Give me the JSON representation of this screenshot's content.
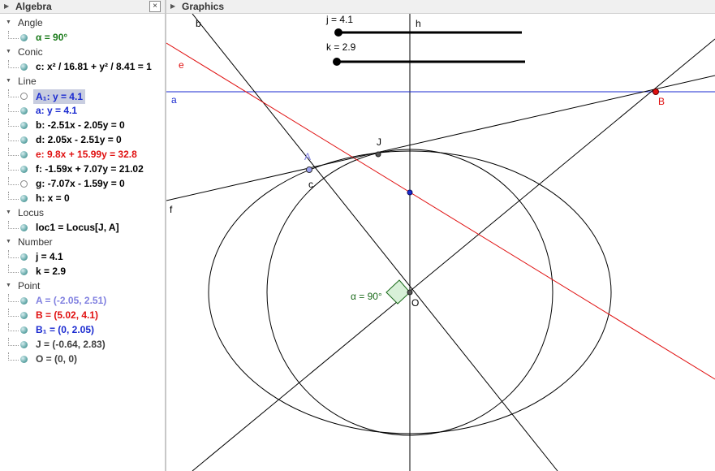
{
  "algebra": {
    "title": "Algebra",
    "close_glyph": "×",
    "groups": [
      {
        "label": "Angle",
        "items": [
          {
            "text": "α = 90°",
            "color": "#1a7a1a",
            "shown": true
          }
        ]
      },
      {
        "label": "Conic",
        "items": [
          {
            "text": "c: x² / 16.81 + y² / 8.41 = 1",
            "color": "#000000",
            "shown": true
          }
        ]
      },
      {
        "label": "Line",
        "items": [
          {
            "text": "A₁: y = 4.1",
            "color": "#1a2ad0",
            "shown": false,
            "selected": true
          },
          {
            "text": "a: y = 4.1",
            "color": "#1a2ad0",
            "shown": true
          },
          {
            "text": "b: -2.51x - 2.05y = 0",
            "color": "#000000",
            "shown": true
          },
          {
            "text": "d: 2.05x - 2.51y = 0",
            "color": "#000000",
            "shown": true
          },
          {
            "text": "e: 9.8x + 15.99y = 32.8",
            "color": "#e01010",
            "shown": true
          },
          {
            "text": "f: -1.59x + 7.07y = 21.02",
            "color": "#000000",
            "shown": true
          },
          {
            "text": "g: -7.07x - 1.59y = 0",
            "color": "#000000",
            "shown": false
          },
          {
            "text": "h: x = 0",
            "color": "#000000",
            "shown": true
          }
        ]
      },
      {
        "label": "Locus",
        "items": [
          {
            "text": "loc1 = Locus[J, A]",
            "color": "#000000",
            "shown": true
          }
        ]
      },
      {
        "label": "Number",
        "items": [
          {
            "text": "j = 4.1",
            "color": "#000000",
            "shown": true
          },
          {
            "text": "k = 2.9",
            "color": "#000000",
            "shown": true
          }
        ]
      },
      {
        "label": "Point",
        "items": [
          {
            "text": "A = (-2.05, 2.51)",
            "color": "#8080e0",
            "shown": true
          },
          {
            "text": "B = (5.02, 4.1)",
            "color": "#e01010",
            "shown": true
          },
          {
            "text": "B₁ = (0, 2.05)",
            "color": "#1a2ad0",
            "shown": true
          },
          {
            "text": "J = (-0.64, 2.83)",
            "color": "#404040",
            "shown": true
          },
          {
            "text": "O = (0, 0)",
            "color": "#404040",
            "shown": true
          }
        ]
      }
    ]
  },
  "graphics": {
    "title": "Graphics",
    "sliders": [
      {
        "label": "j = 4.1",
        "value": 4.1
      },
      {
        "label": "k = 2.9",
        "value": 2.9
      }
    ],
    "labels": {
      "b": "b",
      "h": "h",
      "e": "e",
      "a": "a",
      "B": "B",
      "A": "A",
      "J": "J",
      "c": "c",
      "f": "f",
      "O": "O",
      "alpha": "α = 90°"
    }
  }
}
